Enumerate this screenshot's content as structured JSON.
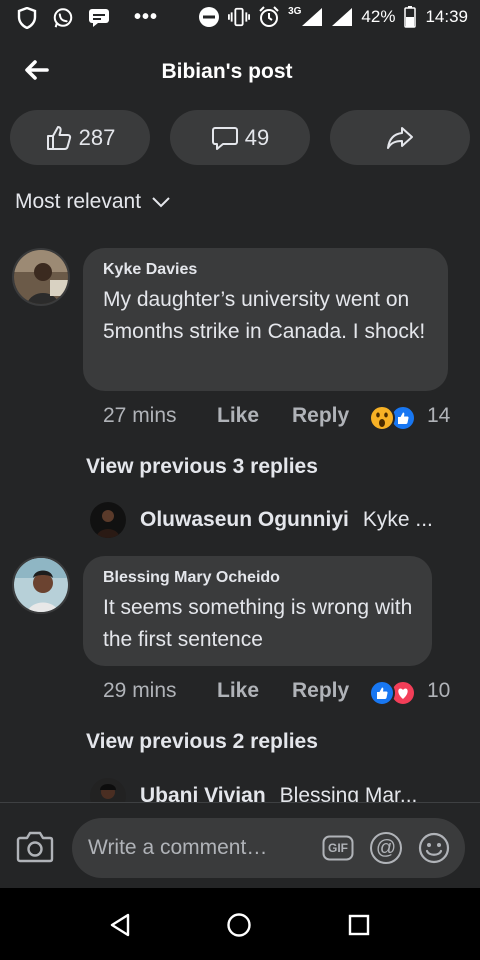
{
  "status_bar": {
    "network": "3G",
    "battery": "42%",
    "time": "14:39",
    "dots": "•••"
  },
  "header": {
    "title": "Bibian's post",
    "back_icon": "arrow-left-icon"
  },
  "stats": {
    "likes": "287",
    "comments": "49",
    "like_icon": "thumbs-up-icon",
    "comment_icon": "speech-bubble-icon",
    "share_icon": "share-arrow-icon"
  },
  "sort": {
    "label": "Most relevant"
  },
  "comments": [
    {
      "author": "Kyke Davies",
      "text": "My daughter’s university went on 5months strike in Canada. I shock!",
      "time": "27 mins",
      "like_label": "Like",
      "reply_label": "Reply",
      "reaction_count": "14",
      "reactions": [
        "wow",
        "like"
      ],
      "view_previous": "View previous 3 replies",
      "reply_preview": {
        "name": "Oluwaseun Ogunniyi",
        "snippet": "Kyke ..."
      }
    },
    {
      "author": "Blessing Mary Ocheido",
      "text": "It seems something is wrong with the first sentence",
      "time": "29 mins",
      "like_label": "Like",
      "reply_label": "Reply",
      "reaction_count": "10",
      "reactions": [
        "like",
        "love"
      ],
      "view_previous": "View previous 2 replies",
      "reply_preview": {
        "name": "Ubani Vivian",
        "snippet": "Blessing Mar..."
      }
    }
  ],
  "composer": {
    "placeholder": "Write a comment…",
    "gif_label": "GIF",
    "mention_label": "@"
  },
  "colors": {
    "background": "#242526",
    "surface": "#3a3b3c",
    "text": "#e4e6eb",
    "muted": "#b0b3b8",
    "like_blue": "#1877f2",
    "love_red": "#f33e58",
    "wow_yellow": "#f7b125"
  }
}
